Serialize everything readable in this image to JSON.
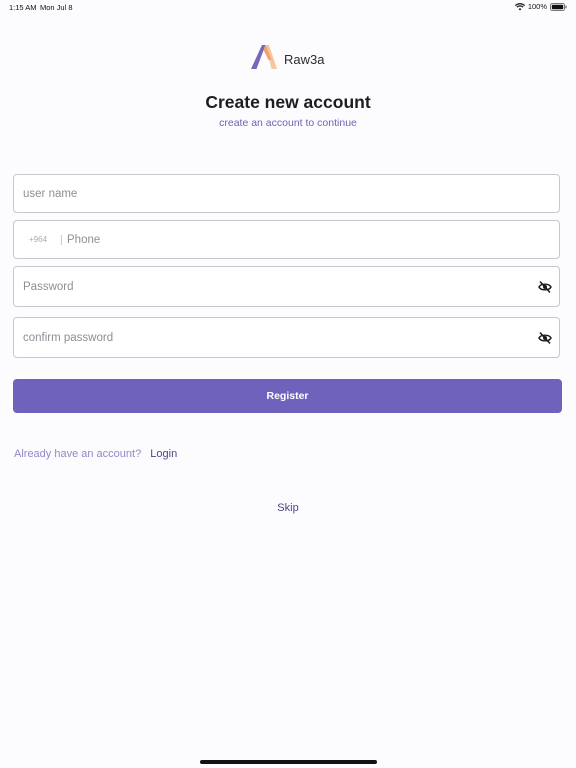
{
  "status_bar": {
    "time": "1:15 AM",
    "date": "Mon Jul 8",
    "battery": "100%",
    "wifi_icon": "wifi-icon",
    "battery_icon": "battery-icon"
  },
  "brand": {
    "name": "Raw3a",
    "logo_icon": "raw3a-logo-icon",
    "logo_colors": [
      "#7468b8",
      "#f1a36f",
      "#f6c79d"
    ]
  },
  "header": {
    "title": "Create new account",
    "subtitle": "create an account to continue"
  },
  "form": {
    "username": {
      "placeholder": "user name",
      "value": ""
    },
    "phone": {
      "country_code": "+964",
      "placeholder": "Phone",
      "value": ""
    },
    "password": {
      "placeholder": "Password",
      "value": "",
      "toggle_icon": "eye-off-icon"
    },
    "confirm_password": {
      "placeholder": "confirm password",
      "value": "",
      "toggle_icon": "eye-off-icon"
    }
  },
  "actions": {
    "register_label": "Register",
    "login_prompt": "Already have an account?",
    "login_label": "Login",
    "skip_label": "Skip"
  },
  "colors": {
    "accent": "#6f62bd",
    "link": "#4d4586",
    "subtitle": "#6d63b6",
    "border": "#c7c7cf",
    "background": "#fcfcfe"
  }
}
